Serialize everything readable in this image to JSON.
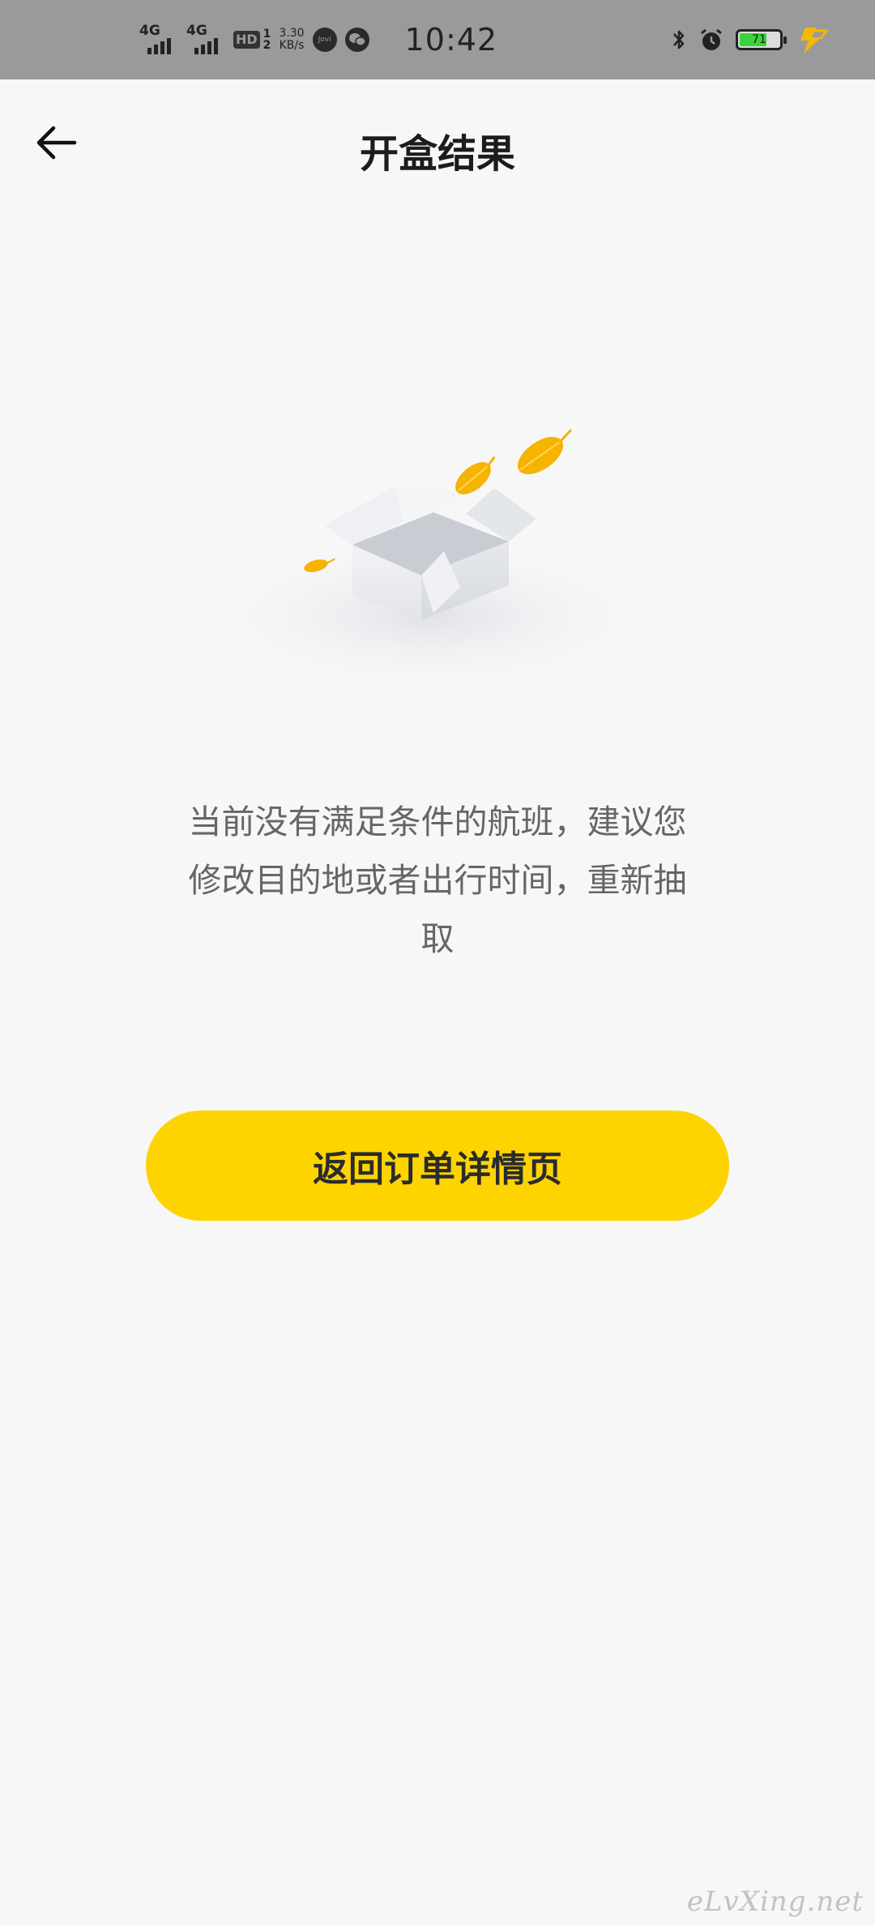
{
  "status_bar": {
    "signal_1": "4G",
    "signal_2": "4G",
    "hd_badge": "HD",
    "hd_sub": "1\n2",
    "speed_value": "3.30",
    "speed_unit": "KB/s",
    "app_icon_1": "Jovi",
    "time": "10:42",
    "battery_level": "71",
    "battery_fraction": 0.71,
    "icons": [
      "bluetooth-icon",
      "alarm-icon",
      "charging-icon"
    ]
  },
  "header": {
    "title": "开盒结果",
    "back_icon": "back-arrow-icon"
  },
  "empty_state": {
    "illustration": "open-box-with-leaves",
    "message": "当前没有满足条件的航班，建议您修改目的地或者出行时间，重新抽取"
  },
  "actions": {
    "return_label": "返回订单详情页"
  },
  "watermark": {
    "text": "eLvXing.net"
  },
  "colors": {
    "accent": "#fdd400",
    "leaf": "#f6b300",
    "background": "#f7f7f8",
    "statusbar": "#9a9a9a"
  }
}
